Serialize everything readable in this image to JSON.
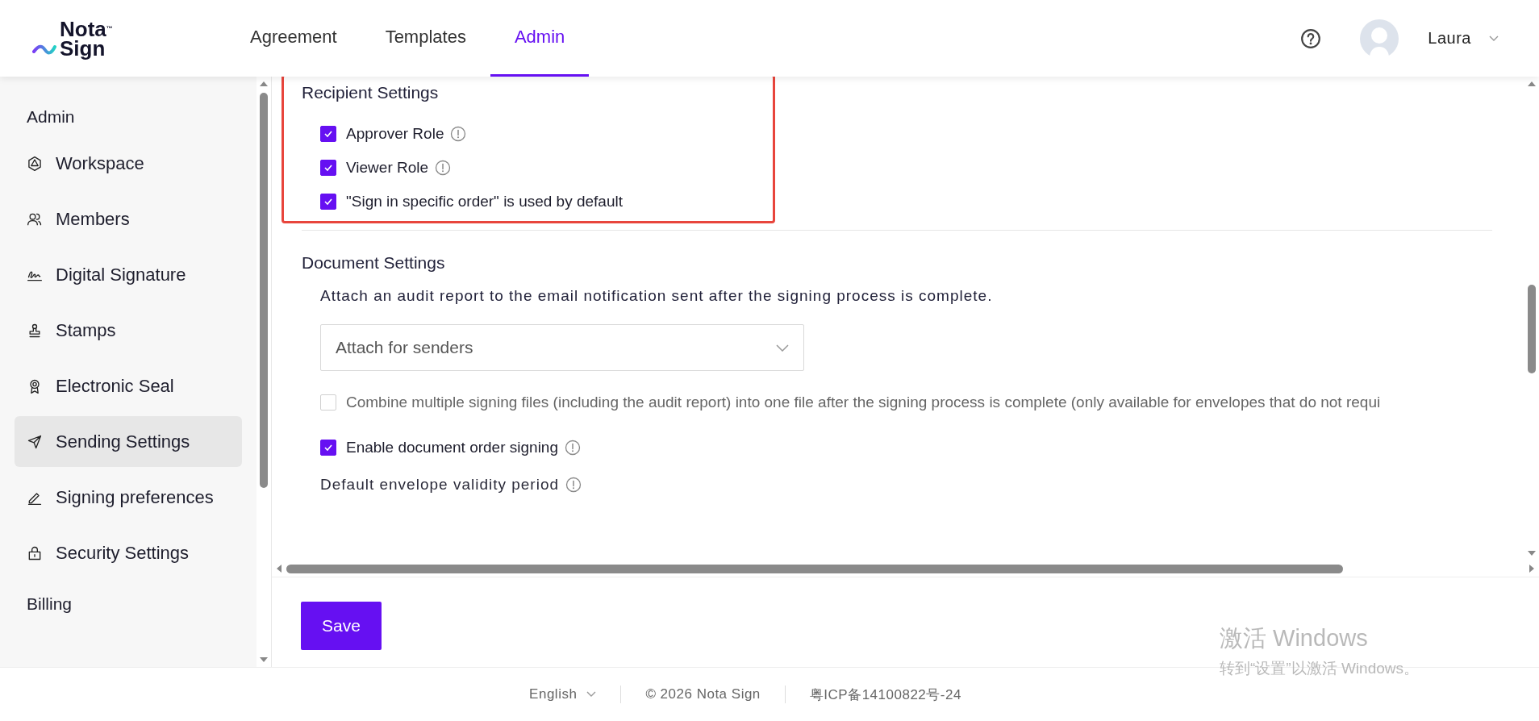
{
  "header": {
    "logo": {
      "line_1": "Nota",
      "trademark": "™",
      "line_2": "Sign"
    },
    "nav": [
      {
        "label": "Agreement",
        "selected": false
      },
      {
        "label": "Templates",
        "selected": false
      },
      {
        "label": "Admin",
        "selected": true
      }
    ],
    "user": {
      "name": "Laura"
    }
  },
  "sidebar": {
    "sections": [
      {
        "title": "Admin",
        "items": [
          {
            "label": "Workspace",
            "selected": false
          },
          {
            "label": "Members",
            "selected": false
          },
          {
            "label": "Digital Signature",
            "selected": false
          },
          {
            "label": "Stamps",
            "selected": false
          },
          {
            "label": "Electronic Seal",
            "selected": false
          },
          {
            "label": "Sending Settings",
            "selected": true
          },
          {
            "label": "Signing preferences",
            "selected": false
          },
          {
            "label": "Security Settings",
            "selected": false
          }
        ]
      },
      {
        "title": "Billing"
      }
    ]
  },
  "recipient_settings": {
    "title": "Recipient Settings",
    "options": [
      {
        "label": "Approver Role",
        "checked": true,
        "info": true
      },
      {
        "label": "Viewer Role",
        "checked": true,
        "info": true
      },
      {
        "label": "\"Sign in specific order\" is used by default",
        "checked": true,
        "info": false
      }
    ]
  },
  "document_settings": {
    "title": "Document Settings",
    "description": "Attach an audit report to the email notification sent after the signing process is complete.",
    "select": {
      "value": "Attach for senders"
    },
    "options": [
      {
        "label": "Combine multiple signing files (including the audit report) into one file after the signing process is complete (only available for envelopes that do not requi",
        "checked": false,
        "disabled": true,
        "info": false
      },
      {
        "label": "Enable document order signing",
        "checked": true,
        "disabled": false,
        "info": true
      }
    ],
    "validity": {
      "label": "Default envelope validity period",
      "info": true
    }
  },
  "save_button": {
    "label": "Save"
  },
  "footer": {
    "language": "English",
    "copyright": "© 2026 Nota Sign",
    "license": "粤ICP备14100822号-24"
  },
  "os_watermark": {
    "title": "激活 Windows",
    "subtitle": "转到“设置”以激活 Windows。"
  }
}
